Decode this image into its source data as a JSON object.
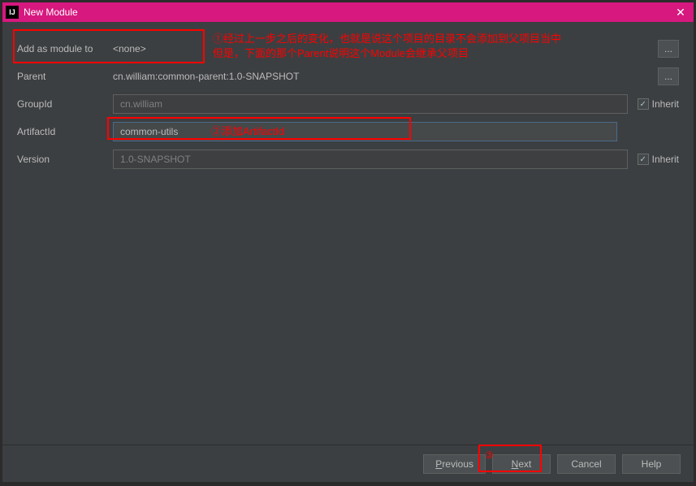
{
  "titlebar": {
    "icon_text": "IJ",
    "title": "New Module",
    "close_glyph": "✕"
  },
  "form": {
    "add_as_module_label": "Add as module to",
    "add_as_module_value": "<none>",
    "parent_label": "Parent",
    "parent_value": "cn.william:common-parent:1.0-SNAPSHOT",
    "groupid_label": "GroupId",
    "groupid_value": "cn.william",
    "artifactid_label": "ArtifactId",
    "artifactid_value": "common-utils",
    "version_label": "Version",
    "version_value": "1.0-SNAPSHOT",
    "inherit_label": "Inherit",
    "browse_glyph": "...",
    "check_glyph": "✓"
  },
  "annotations": {
    "note1": "①经过上一步之后的变化，也就是说这个项目的目录不会添加到父项目当中\n但是，下面的那个Parent说明这个Module会继承父项目",
    "note2": "②添加ArtifactId",
    "note3": "③"
  },
  "footer": {
    "previous_label_pre": "",
    "previous_mnemonic": "P",
    "previous_label_post": "revious",
    "next_mnemonic": "N",
    "next_label_post": "ext",
    "cancel_label": "Cancel",
    "help_label": "Help"
  }
}
